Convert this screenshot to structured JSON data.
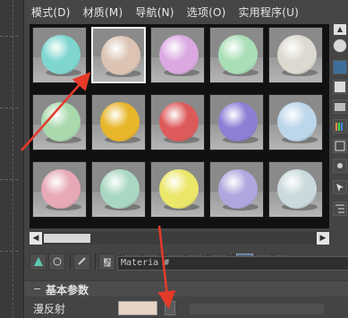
{
  "menubar": {
    "items": [
      "模式(D)",
      "材质(M)",
      "导航(N)",
      "选项(O)",
      "实用程序(U)"
    ]
  },
  "material_slots": [
    {
      "color": "#7ed6cf",
      "selected": false
    },
    {
      "color": "#dcc3b3",
      "selected": true
    },
    {
      "color": "#dba8e2",
      "selected": false
    },
    {
      "color": "#a9dfb6",
      "selected": false
    },
    {
      "color": "#dcd9d0",
      "selected": false
    },
    {
      "color": "#a9d9ad",
      "selected": false
    },
    {
      "color": "#e8b62a",
      "selected": false
    },
    {
      "color": "#dd5a5a",
      "selected": false
    },
    {
      "color": "#8d7fd6",
      "selected": false
    },
    {
      "color": "#bcd6ea",
      "selected": false
    },
    {
      "color": "#e7a9b6",
      "selected": false
    },
    {
      "color": "#a9d8c2",
      "selected": false
    },
    {
      "color": "#ebe76a",
      "selected": false
    },
    {
      "color": "#b1a6de",
      "selected": false
    },
    {
      "color": "#c9d9dc",
      "selected": false
    }
  ],
  "name_row": {
    "material_name": "Materia  #"
  },
  "rollout": {
    "title": "基本参数",
    "collapse_glyph": "−"
  },
  "diffuse": {
    "label": "漫反射",
    "color": "#e8d4c6"
  },
  "annotation_color": "#e53a2a"
}
